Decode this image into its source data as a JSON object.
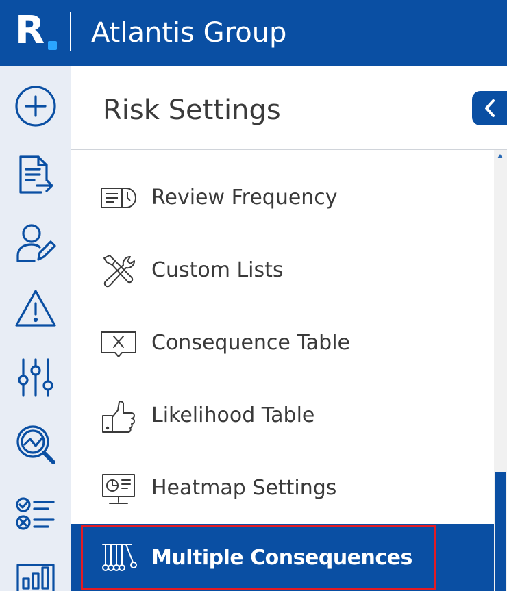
{
  "header": {
    "logo_letter": "R",
    "org_name": "Atlantis Group",
    "brand_color": "#0a4fa3",
    "dot_color": "#2aa5ff"
  },
  "rail": {
    "items": [
      {
        "name": "add-icon"
      },
      {
        "name": "document-export-icon"
      },
      {
        "name": "user-edit-icon"
      },
      {
        "name": "warning-icon"
      },
      {
        "name": "sliders-icon"
      },
      {
        "name": "analytics-search-icon"
      },
      {
        "name": "checklist-icon"
      },
      {
        "name": "bar-chart-icon"
      }
    ]
  },
  "panel": {
    "title": "Risk Settings",
    "collapse_icon": "chevron-left-icon"
  },
  "menu": {
    "items": [
      {
        "label": "Review Frequency",
        "icon": "review-frequency-icon",
        "active": false
      },
      {
        "label": "Custom Lists",
        "icon": "tools-icon",
        "active": false
      },
      {
        "label": "Consequence Table",
        "icon": "consequence-table-icon",
        "active": false
      },
      {
        "label": "Likelihood Table",
        "icon": "thumbs-up-icon",
        "active": false
      },
      {
        "label": "Heatmap Settings",
        "icon": "heatmap-monitor-icon",
        "active": false
      },
      {
        "label": "Multiple Consequences",
        "icon": "newtons-cradle-icon",
        "active": true
      }
    ],
    "active_color": "#0a4fa3",
    "highlight_outline_color": "#e31b23"
  }
}
